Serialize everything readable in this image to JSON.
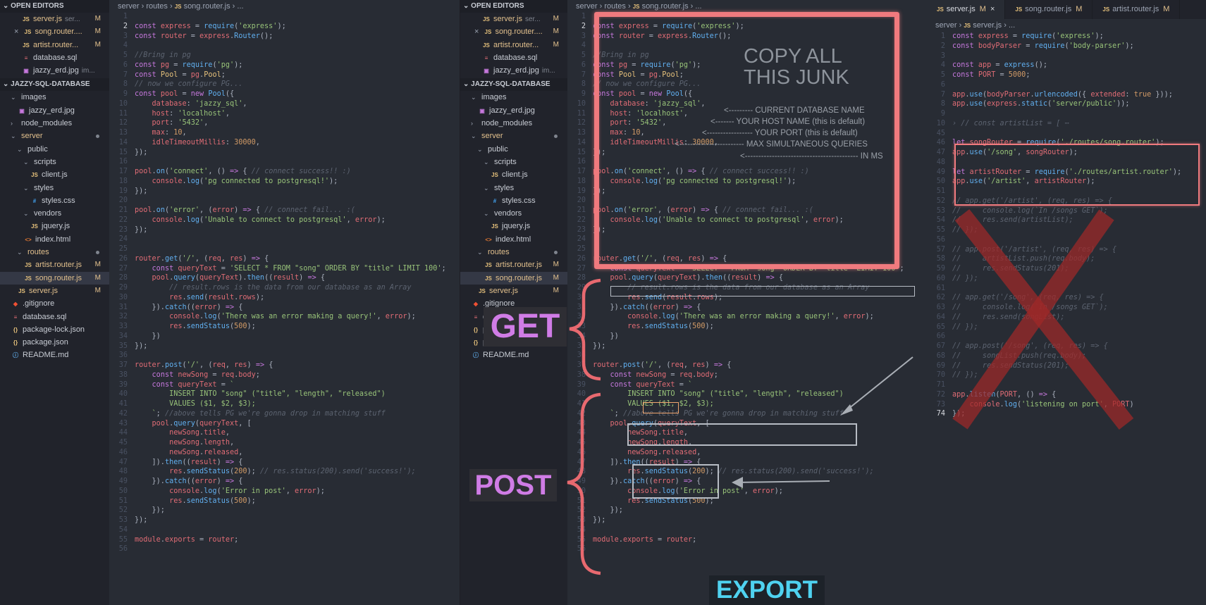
{
  "sidebar": {
    "open_editors_title": "OPEN EDITORS",
    "project_title": "JAZZY-SQL-DATABASE",
    "open_editors": [
      {
        "name": "server.js",
        "sub": "ser...",
        "badge": "M",
        "icon": "js"
      },
      {
        "name": "song.router....",
        "sub": "",
        "badge": "M",
        "icon": "js",
        "close": "×"
      },
      {
        "name": "artist.router...",
        "sub": "",
        "badge": "M",
        "icon": "js"
      },
      {
        "name": "database.sql",
        "sub": "",
        "badge": "",
        "icon": "db"
      },
      {
        "name": "jazzy_erd.jpg",
        "sub": "im...",
        "badge": "",
        "icon": "img"
      }
    ],
    "tree": [
      {
        "name": "images",
        "indent": 1,
        "type": "folder-open"
      },
      {
        "name": "jazzy_erd.jpg",
        "indent": 2,
        "type": "img"
      },
      {
        "name": "node_modules",
        "indent": 1,
        "type": "folder"
      },
      {
        "name": "server",
        "indent": 1,
        "type": "folder-open",
        "mod": true,
        "dot": true
      },
      {
        "name": "public",
        "indent": 2,
        "type": "folder-open"
      },
      {
        "name": "scripts",
        "indent": 3,
        "type": "folder-open"
      },
      {
        "name": "client.js",
        "indent": 4,
        "type": "js"
      },
      {
        "name": "styles",
        "indent": 3,
        "type": "folder-open"
      },
      {
        "name": "styles.css",
        "indent": 4,
        "type": "css"
      },
      {
        "name": "vendors",
        "indent": 3,
        "type": "folder-open"
      },
      {
        "name": "jquery.js",
        "indent": 4,
        "type": "js"
      },
      {
        "name": "index.html",
        "indent": 3,
        "type": "html"
      },
      {
        "name": "routes",
        "indent": 2,
        "type": "folder-open",
        "mod": true,
        "dot": true
      },
      {
        "name": "artist.router.js",
        "indent": 3,
        "type": "js",
        "mod": true,
        "badge": "M"
      },
      {
        "name": "song.router.js",
        "indent": 3,
        "type": "js",
        "mod": true,
        "badge": "M",
        "selected": true
      },
      {
        "name": "server.js",
        "indent": 2,
        "type": "js",
        "mod": true,
        "badge": "M"
      },
      {
        "name": ".gitignore",
        "indent": 1,
        "type": "git"
      },
      {
        "name": "database.sql",
        "indent": 1,
        "type": "db"
      },
      {
        "name": "package-lock.json",
        "indent": 1,
        "type": "json"
      },
      {
        "name": "package.json",
        "indent": 1,
        "type": "json"
      },
      {
        "name": "README.md",
        "indent": 1,
        "type": "info"
      }
    ]
  },
  "icons": {
    "js": "JS",
    "db": "≡",
    "img": "▣",
    "css": "#",
    "html": "<>",
    "git": "◆",
    "json": "{}",
    "info": "ⓘ",
    "folder": "›",
    "folder-open": "⌄"
  },
  "breadcrumb": {
    "parts": [
      "server",
      "routes",
      "song.router.js",
      "..."
    ]
  },
  "breadcrumb_server": {
    "parts": [
      "server",
      "server.js",
      "..."
    ]
  },
  "right_tabs": [
    {
      "label": "server.js",
      "badge": "M",
      "active": true,
      "close": "×"
    },
    {
      "label": "song.router.js",
      "badge": "M"
    },
    {
      "label": "artist.router.js",
      "badge": "M"
    }
  ],
  "song_router_lines": [
    {
      "n": 1,
      "h": ""
    },
    {
      "n": 2,
      "h": "<span class='k'>const</span> <span class='v'>express</span> = <span class='f'>require</span>(<span class='s'>'express'</span>);"
    },
    {
      "n": 3,
      "h": "<span class='k'>const</span> <span class='v'>router</span> = <span class='v'>express</span>.<span class='f'>Router</span>();"
    },
    {
      "n": 4,
      "h": ""
    },
    {
      "n": 5,
      "h": "<span class='cm'>//Bring in pg</span>"
    },
    {
      "n": 6,
      "h": "<span class='k'>const</span> <span class='v'>pg</span> = <span class='f'>require</span>(<span class='s'>'pg'</span>);"
    },
    {
      "n": 7,
      "h": "<span class='k'>const</span> <span class='t'>Pool</span> = <span class='v'>pg</span>.<span class='t'>Pool</span>;"
    },
    {
      "n": 8,
      "h": "<span class='cm'>// now we configure PG...</span>"
    },
    {
      "n": 9,
      "h": "<span class='k'>const</span> <span class='v'>pool</span> = <span class='k'>new</span> <span class='f'>Pool</span>({"
    },
    {
      "n": 10,
      "h": "    <span class='v'>database</span>: <span class='s'>'jazzy_sql'</span>,"
    },
    {
      "n": 11,
      "h": "    <span class='v'>host</span>: <span class='s'>'localhost'</span>,"
    },
    {
      "n": 12,
      "h": "    <span class='v'>port</span>: <span class='s'>'5432'</span>,"
    },
    {
      "n": 13,
      "h": "    <span class='v'>max</span>: <span class='num'>10</span>,"
    },
    {
      "n": 14,
      "h": "    <span class='v'>idleTimeoutMillis</span>: <span class='num'>30000</span>,"
    },
    {
      "n": 15,
      "h": "});"
    },
    {
      "n": 16,
      "h": ""
    },
    {
      "n": 17,
      "h": "<span class='v'>pool</span>.<span class='f'>on</span>(<span class='s'>'connect'</span>, () <span class='k'>=></span> { <span class='cm'>// connect success!! :)</span>"
    },
    {
      "n": 18,
      "h": "    <span class='v'>console</span>.<span class='f'>log</span>(<span class='s'>'pg connected to postgresql!'</span>);"
    },
    {
      "n": 19,
      "h": "});"
    },
    {
      "n": 20,
      "h": ""
    },
    {
      "n": 21,
      "h": "<span class='v'>pool</span>.<span class='f'>on</span>(<span class='s'>'error'</span>, (<span class='v'>error</span>) <span class='k'>=></span> { <span class='cm'>// connect fail... :(</span>"
    },
    {
      "n": 22,
      "h": "    <span class='v'>console</span>.<span class='f'>log</span>(<span class='s'>'Unable to connect to postgresql'</span>, <span class='v'>error</span>);"
    },
    {
      "n": 23,
      "h": "});"
    },
    {
      "n": 24,
      "h": ""
    },
    {
      "n": 25,
      "h": ""
    },
    {
      "n": 26,
      "h": "<span class='v'>router</span>.<span class='f'>get</span>(<span class='s'>'/'</span>, (<span class='v'>req</span>, <span class='v'>res</span>) <span class='k'>=></span> {"
    },
    {
      "n": 27,
      "h": "    <span class='k'>const</span> <span class='v'>queryText</span> = <span class='s'>'SELECT * FROM \"song\" ORDER BY \"title\" LIMIT 100'</span>;"
    },
    {
      "n": 28,
      "h": "    <span class='v'>pool</span>.<span class='f'>query</span>(<span class='v'>queryText</span>).<span class='f'>then</span>((<span class='v'>result</span>) <span class='k'>=></span> {"
    },
    {
      "n": 29,
      "h": "        <span class='cm'>// result.rows is the data from our database as an Array</span>"
    },
    {
      "n": 30,
      "h": "        <span class='v'>res</span>.<span class='f'>send</span>(<span class='v'>result</span>.<span class='v'>rows</span>);"
    },
    {
      "n": 31,
      "h": "    }).<span class='f'>catch</span>((<span class='v'>error</span>) <span class='k'>=></span> {"
    },
    {
      "n": 32,
      "h": "        <span class='v'>console</span>.<span class='f'>log</span>(<span class='s'>'There was an error making a query!'</span>, <span class='v'>error</span>);"
    },
    {
      "n": 33,
      "h": "        <span class='v'>res</span>.<span class='f'>sendStatus</span>(<span class='num'>500</span>);"
    },
    {
      "n": 34,
      "h": "    })"
    },
    {
      "n": 35,
      "h": "});"
    },
    {
      "n": 36,
      "h": ""
    },
    {
      "n": 37,
      "h": "<span class='v'>router</span>.<span class='f'>post</span>(<span class='s'>'/'</span>, (<span class='v'>req</span>, <span class='v'>res</span>) <span class='k'>=></span> {"
    },
    {
      "n": 38,
      "h": "    <span class='k'>const</span> <span class='v'>newSong</span> = <span class='v'>req</span>.<span class='v'>body</span>;"
    },
    {
      "n": 39,
      "h": "    <span class='k'>const</span> <span class='v'>queryText</span> = <span class='s'>`</span>"
    },
    {
      "n": 40,
      "h": "<span class='s'>        INSERT INTO \"song\" (\"title\", \"length\", \"released\")</span>"
    },
    {
      "n": 41,
      "h": "<span class='s'>        VALUES ($1, $2, $3);</span>"
    },
    {
      "n": 42,
      "h": "<span class='s'>    `</span>; <span class='cm'>//above tells PG we're gonna drop in matching stuff</span>"
    },
    {
      "n": 43,
      "h": "    <span class='v'>pool</span>.<span class='f'>query</span>(<span class='v'>queryText</span>, ["
    },
    {
      "n": 44,
      "h": "        <span class='v'>newSong</span>.<span class='v'>title</span>,"
    },
    {
      "n": 45,
      "h": "        <span class='v'>newSong</span>.<span class='v'>length</span>,"
    },
    {
      "n": 46,
      "h": "        <span class='v'>newSong</span>.<span class='v'>released</span>,"
    },
    {
      "n": 47,
      "h": "    ]).<span class='f'>then</span>((<span class='v'>result</span>) <span class='k'>=></span> {"
    },
    {
      "n": 48,
      "h": "        <span class='v'>res</span>.<span class='f'>sendStatus</span>(<span class='num'>200</span>); <span class='cm'>// res.status(200).send('success!');</span>"
    },
    {
      "n": 49,
      "h": "    }).<span class='f'>catch</span>((<span class='v'>error</span>) <span class='k'>=></span> {"
    },
    {
      "n": 50,
      "h": "        <span class='v'>console</span>.<span class='f'>log</span>(<span class='s'>'Error in post'</span>, <span class='v'>error</span>);"
    },
    {
      "n": 51,
      "h": "        <span class='v'>res</span>.<span class='f'>sendStatus</span>(<span class='num'>500</span>);"
    },
    {
      "n": 52,
      "h": "    });"
    },
    {
      "n": 53,
      "h": "});"
    },
    {
      "n": 54,
      "h": ""
    },
    {
      "n": 55,
      "h": "<span class='v'>module</span>.<span class='v'>exports</span> = <span class='v'>router</span>;"
    },
    {
      "n": 56,
      "h": ""
    }
  ],
  "server_lines": [
    {
      "n": 1,
      "h": "<span class='k'>const</span> <span class='v'>express</span> = <span class='f'>require</span>(<span class='s'>'express'</span>);"
    },
    {
      "n": 2,
      "h": "<span class='k'>const</span> <span class='v'>bodyParser</span> = <span class='f'>require</span>(<span class='s'>'body-parser'</span>);"
    },
    {
      "n": 3,
      "h": ""
    },
    {
      "n": 4,
      "h": "<span class='k'>const</span> <span class='v'>app</span> = <span class='f'>express</span>();"
    },
    {
      "n": 5,
      "h": "<span class='k'>const</span> <span class='v'>PORT</span> = <span class='num'>5000</span>;"
    },
    {
      "n": 6,
      "h": ""
    },
    {
      "n": 7,
      "h": "<span class='v'>app</span>.<span class='f'>use</span>(<span class='v'>bodyParser</span>.<span class='f'>urlencoded</span>({ <span class='v'>extended</span>: <span class='num'>true</span> }));"
    },
    {
      "n": 8,
      "h": "<span class='v'>app</span>.<span class='f'>use</span>(<span class='v'>express</span>.<span class='f'>static</span>(<span class='s'>'server/public'</span>));"
    },
    {
      "n": 9,
      "h": ""
    },
    {
      "n": 10,
      "h": "<span class='cm'>› // const artistList = [ ⋯</span>"
    },
    {
      "n": 45,
      "h": ""
    },
    {
      "n": 46,
      "h": "<span class='k'>let</span> <span class='v'>songRouter</span> = <span class='f'>require</span>(<span class='s'>'./routes/song.router'</span>);"
    },
    {
      "n": 47,
      "h": "<span class='v'>app</span>.<span class='f'>use</span>(<span class='s'>'/song'</span>, <span class='v'>songRouter</span>);"
    },
    {
      "n": 48,
      "h": ""
    },
    {
      "n": 49,
      "h": "<span class='k'>let</span> <span class='v'>artistRouter</span> = <span class='f'>require</span>(<span class='s'>'./routes/artist.router'</span>);"
    },
    {
      "n": 50,
      "h": "<span class='v'>app</span>.<span class='f'>use</span>(<span class='s'>'/artist'</span>, <span class='v'>artistRouter</span>);"
    },
    {
      "n": 51,
      "h": ""
    },
    {
      "n": 52,
      "h": "<span class='cm'>// app.get('/artist', (req, res) => {</span>"
    },
    {
      "n": 53,
      "h": "<span class='cm'>//     console.log(`In /songs GET`);</span>"
    },
    {
      "n": 54,
      "h": "<span class='cm'>//     res.send(artistList);</span>"
    },
    {
      "n": 55,
      "h": "<span class='cm'>// });</span>"
    },
    {
      "n": 56,
      "h": ""
    },
    {
      "n": 57,
      "h": "<span class='cm'>// app.post('/artist', (req, res) => {</span>"
    },
    {
      "n": 58,
      "h": "<span class='cm'>//     artistList.push(req.body);</span>"
    },
    {
      "n": 59,
      "h": "<span class='cm'>//     res.sendStatus(201);</span>"
    },
    {
      "n": 60,
      "h": "<span class='cm'>// });</span>"
    },
    {
      "n": 61,
      "h": ""
    },
    {
      "n": 62,
      "h": "<span class='cm'>// app.get('/song', (req, res) => {</span>"
    },
    {
      "n": 63,
      "h": "<span class='cm'>//     console.log(`In /songs GET`);</span>"
    },
    {
      "n": 64,
      "h": "<span class='cm'>//     res.send(songList);</span>"
    },
    {
      "n": 65,
      "h": "<span class='cm'>// });</span>"
    },
    {
      "n": 66,
      "h": ""
    },
    {
      "n": 67,
      "h": "<span class='cm'>// app.post('/song', (req, res) => {</span>"
    },
    {
      "n": 68,
      "h": "<span class='cm'>//     songList.push(req.body);</span>"
    },
    {
      "n": 69,
      "h": "<span class='cm'>//     res.sendStatus(201);</span>"
    },
    {
      "n": 70,
      "h": "<span class='cm'>// });</span>"
    },
    {
      "n": 71,
      "h": ""
    },
    {
      "n": 72,
      "h": "<span class='v'>app</span>.<span class='f'>listen</span>(<span class='v'>PORT</span>, () <span class='k'>=></span> {"
    },
    {
      "n": 73,
      "h": "    <span class='v'>console</span>.<span class='f'>log</span>(<span class='s'>'listening on port'</span>, <span class='v'>PORT</span>)"
    },
    {
      "n": 74,
      "h": "});"
    }
  ],
  "annotations": {
    "copy_all": "COPY ALL THIS JUNK",
    "get": "GET",
    "post": "POST",
    "export": "EXPORT",
    "db_name": "<--------- CURRENT DATABASE NAME",
    "host_name": "<------- YOUR HOST NAME (this is default)",
    "port_name": "<----------------- YOUR PORT (this is default)",
    "max_name": "<------------------------ MAX SIMULTANEOUS QUERIES",
    "ms_name": "<------------------------------------------ IN MS"
  },
  "colors": {
    "label_purple": "#d07ce6",
    "export_cyan": "#4fd2f0",
    "red_box": "#f07a7e",
    "big_x": "#a02828"
  }
}
